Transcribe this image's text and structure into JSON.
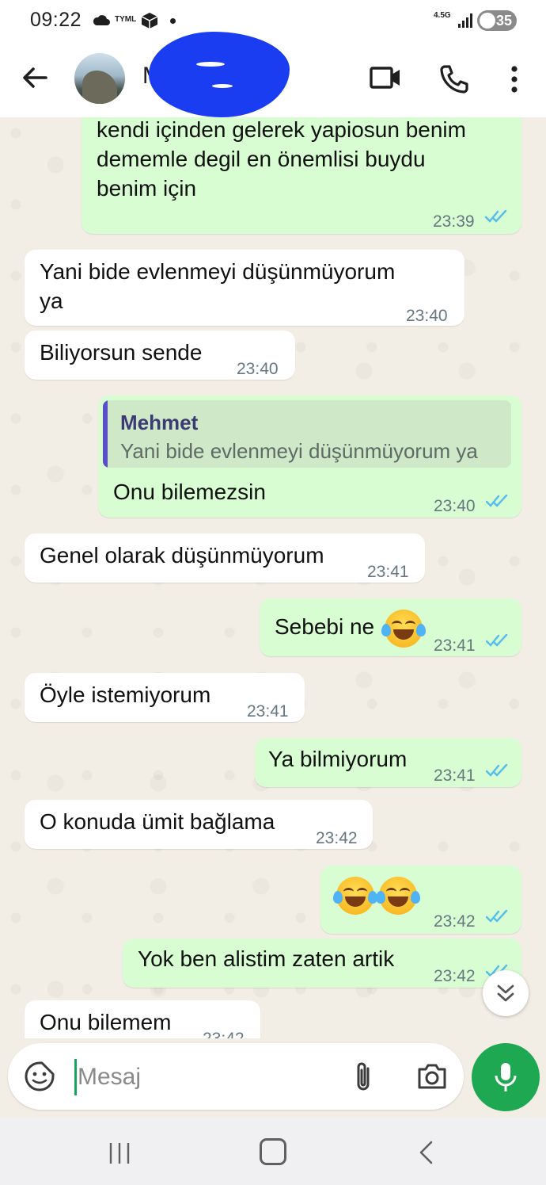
{
  "status_bar": {
    "time": "09:22",
    "carrier_badge": "TYML",
    "network": "4.5G",
    "battery": "35"
  },
  "header": {
    "contact_name": "M",
    "icons": [
      "back-arrow-icon",
      "video-call-icon",
      "phone-icon",
      "more-vert-icon"
    ]
  },
  "messages": [
    {
      "dir": "out",
      "text": "yanyana gelince gösteriosun ve bunu\nkendi içinden gelerek yapiosun benim\ndememle degil en önemlisi buydu\nbenim için",
      "time": "23:39",
      "read": true
    },
    {
      "dir": "in",
      "text": "Yani bide evlenmeyi düşünmüyorum\nya",
      "time": "23:40"
    },
    {
      "dir": "in",
      "text": "Biliyorsun sende",
      "time": "23:40"
    },
    {
      "dir": "out",
      "quote_author": "Mehmet",
      "quote_text": "Yani bide evlenmeyi düşünmüyorum ya",
      "text": "Onu bilemezsin",
      "time": "23:40",
      "read": true
    },
    {
      "dir": "in",
      "text": "Genel olarak düşünmüyorum",
      "time": "23:41"
    },
    {
      "dir": "out",
      "text": "Sebebi ne",
      "emoji": "face-with-tears-of-joy",
      "time": "23:41",
      "read": true
    },
    {
      "dir": "in",
      "text": "Öyle istemiyorum",
      "time": "23:41"
    },
    {
      "dir": "out",
      "text": "Ya bilmiyorum",
      "time": "23:41",
      "read": true
    },
    {
      "dir": "in",
      "text": "O konuda ümit bağlama",
      "time": "23:42"
    },
    {
      "dir": "out",
      "emoji": "face-with-tears-of-joy x2",
      "time": "23:42",
      "read": true
    },
    {
      "dir": "out",
      "text": "Yok ben alistim zaten artik",
      "time": "23:42",
      "read": true
    },
    {
      "dir": "in",
      "text": "Onu bilemem",
      "time": "23:42"
    }
  ],
  "input": {
    "placeholder": "Mesaj"
  },
  "colors": {
    "incoming_bubble": "#ffffff",
    "outgoing_bubble": "#d9fdd3",
    "read_ticks": "#53bdeb",
    "accent_green": "#1da851",
    "chat_background": "#f3eee5"
  }
}
